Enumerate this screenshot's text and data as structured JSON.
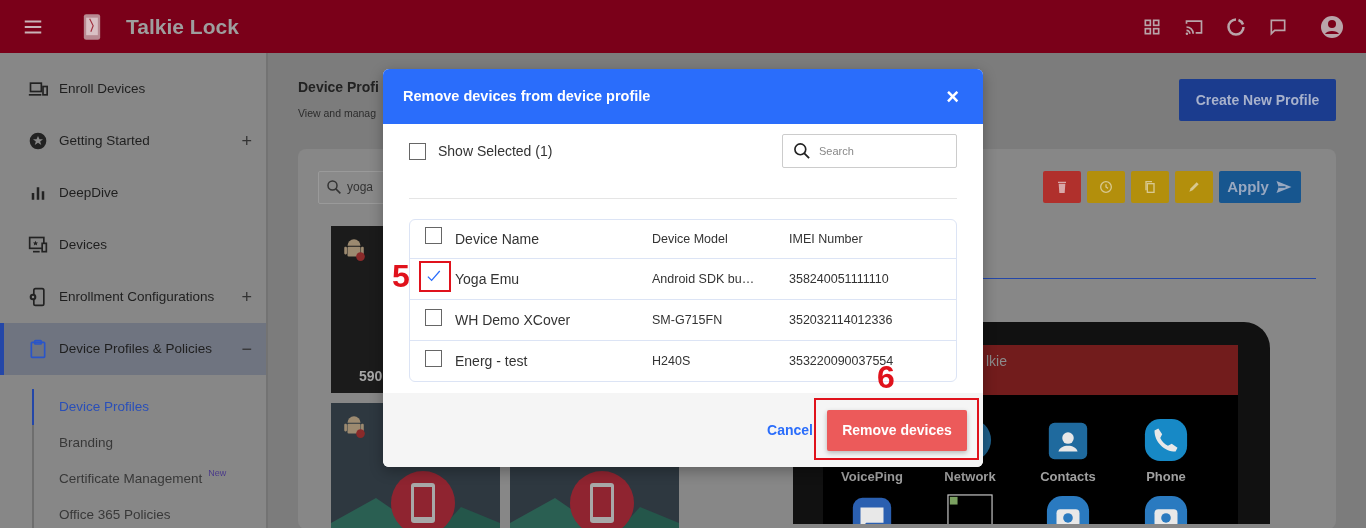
{
  "header": {
    "title": "Talkie Lock"
  },
  "sidebar": {
    "items": [
      {
        "label": "Enroll Devices",
        "selected": false
      },
      {
        "label": "Getting Started",
        "toggle": "+",
        "selected": false
      },
      {
        "label": "DeepDive",
        "selected": false
      },
      {
        "label": "Devices",
        "selected": false
      },
      {
        "label": "Enrollment Configurations",
        "toggle": "+",
        "selected": false
      },
      {
        "label": "Device Profiles & Policies",
        "toggle": "−",
        "selected": true,
        "children": [
          {
            "label": "Device Profiles",
            "selected": true
          },
          {
            "label": "Branding",
            "selected": false
          },
          {
            "label": "Certificate Management",
            "badge": "New",
            "selected": false
          },
          {
            "label": "Office 365 Policies",
            "selected": false
          }
        ]
      }
    ]
  },
  "page": {
    "title": "Device Profi",
    "subtitle": "View and manag",
    "create_button": "Create New Profile"
  },
  "profiles_panel": {
    "search_value": "yoga",
    "tiles": [
      {
        "kind": "dark",
        "caption": "590"
      },
      {
        "kind": "picture"
      },
      {
        "kind": "picture"
      }
    ],
    "action_buttons": [
      {
        "kind": "delete"
      },
      {
        "kind": "schedule"
      },
      {
        "kind": "copy"
      },
      {
        "kind": "edit"
      },
      {
        "kind": "apply",
        "label": "Apply"
      }
    ],
    "preview": {
      "app_title": "lkie",
      "apps": [
        {
          "label": "VoicePing"
        },
        {
          "label": "Network",
          "kind": "network"
        },
        {
          "label": "Contacts",
          "kind": "contacts"
        },
        {
          "label": "Phone",
          "kind": "phone"
        },
        {
          "kind": "messages"
        },
        {
          "kind": "broken-image"
        },
        {
          "kind": "camera"
        },
        {
          "kind": "camera"
        }
      ]
    }
  },
  "dialog": {
    "title": "Remove devices from device profile",
    "close": "×",
    "show_selected": {
      "label": "Show Selected (1)",
      "checked": false
    },
    "search": {
      "placeholder": "Search"
    },
    "table": {
      "columns": [
        "Device Name",
        "Device Model",
        "IMEI Number"
      ],
      "all_checked": false,
      "rows": [
        {
          "name": "Yoga Emu",
          "model": "Android SDK bu…",
          "imei": "358240051111110",
          "selected": true
        },
        {
          "name": "WH Demo XCover",
          "model": "SM-G715FN",
          "imei": "352032114012336",
          "selected": false
        },
        {
          "name": "Energ - test",
          "model": "H240S",
          "imei": "353220090037554",
          "selected": false
        }
      ]
    },
    "cancel": "Cancel",
    "confirm": "Remove devices"
  },
  "annotations": [
    {
      "label": "5"
    },
    {
      "label": "6"
    }
  ]
}
